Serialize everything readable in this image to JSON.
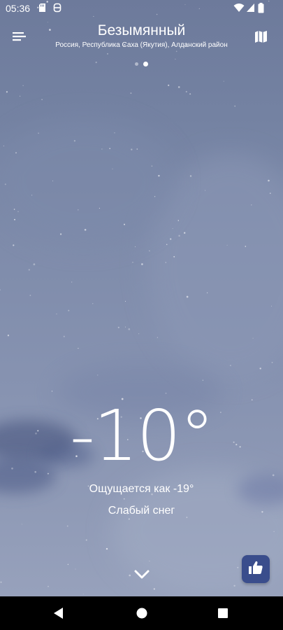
{
  "status_bar": {
    "time": "05:36",
    "left_icons": [
      "sd-card-icon",
      "notification-app-icon"
    ],
    "right_icons": [
      "wifi-icon",
      "cell-signal-icon",
      "battery-icon"
    ]
  },
  "header": {
    "menu_icon": "menu-icon",
    "city": "Безымянный",
    "region": "Россия, Республика Саха (Якутия), Алданский район",
    "map_icon": "map-icon",
    "pager": {
      "count": 2,
      "active_index": 1
    }
  },
  "weather": {
    "temperature": "-10°",
    "feels_like": "Ощущается как -19°",
    "condition": "Слабый снег"
  },
  "actions": {
    "expand_icon": "chevron-down-icon",
    "like_icon": "thumbs-up-icon",
    "like_color": "#3a4d8c"
  },
  "nav_bar": {
    "icons": [
      "back-icon",
      "home-icon",
      "recent-apps-icon"
    ]
  },
  "colors": {
    "sky_top": "#6d7a9b",
    "sky_bottom": "#9aa4be",
    "text": "#ffffff",
    "nav_bar": "#000000"
  }
}
